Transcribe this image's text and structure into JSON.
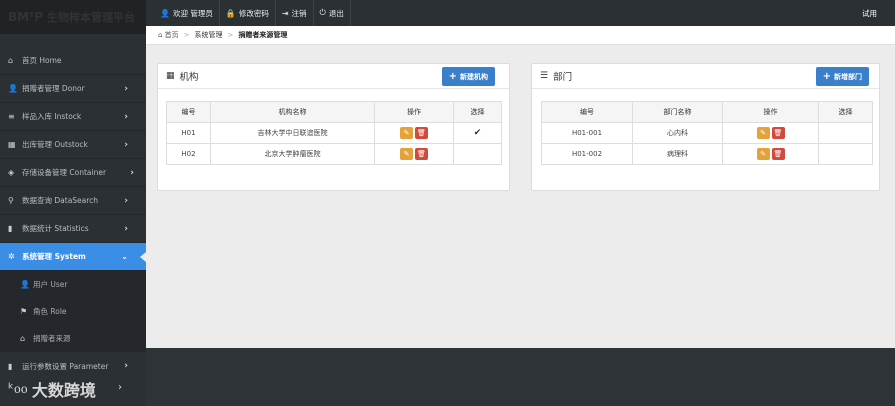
{
  "brand": {
    "logo": "BMᵀP",
    "title": "生物样本管理平台"
  },
  "topnav": [
    {
      "icon": "user-icon",
      "glyph": "👤",
      "label": "欢迎 管理员"
    },
    {
      "icon": "lock-icon",
      "glyph": "🔒",
      "label": "修改密码"
    },
    {
      "icon": "logout-icon",
      "glyph": "⇥",
      "label": "注销"
    },
    {
      "icon": "power-icon",
      "glyph": "⏻",
      "label": "退出"
    }
  ],
  "trial": "试用",
  "breadcrumb": {
    "home": "首页",
    "section": "系统管理",
    "current": "捐赠者来源管理"
  },
  "sidebar": {
    "items": [
      {
        "label": "首页 Home",
        "glyph": "⌂"
      },
      {
        "label": "捐赠者管理 Donor",
        "glyph": "👤"
      },
      {
        "label": "样品入库 Instock",
        "glyph": "≡"
      },
      {
        "label": "出库管理 Outstock",
        "glyph": "▦"
      },
      {
        "label": "存储设备管理 Container",
        "glyph": "◈"
      },
      {
        "label": "数据查询 DataSearch",
        "glyph": "⚲"
      },
      {
        "label": "数据统计 Statistics",
        "glyph": "▮"
      },
      {
        "label": "系统管理 System",
        "glyph": "✲"
      }
    ],
    "sub_items": [
      {
        "label": "用户 User",
        "glyph": "👤"
      },
      {
        "label": "角色 Role",
        "glyph": "⚑"
      },
      {
        "label": "捐赠者来源",
        "glyph": "⌂"
      }
    ],
    "bottom_item": {
      "label": "运行参数设置 Parameter",
      "glyph": "▮"
    }
  },
  "watermark": {
    "logo": "ᵏ᧐᧐",
    "text": "大数跨境"
  },
  "org_panel": {
    "title": "机构",
    "new_button": "新建机构",
    "headers": [
      "编号",
      "机构名称",
      "操作",
      "选择"
    ],
    "rows": [
      {
        "code": "H01",
        "name": "吉林大学中日联谊医院",
        "selected": "✔"
      },
      {
        "code": "H02",
        "name": "北京大学肿瘤医院",
        "selected": ""
      }
    ]
  },
  "dept_panel": {
    "title": "部门",
    "new_button": "新增部门",
    "headers": [
      "编号",
      "部门名称",
      "操作",
      "选择"
    ],
    "rows": [
      {
        "code": "H01-001",
        "name": "心内科",
        "selected": ""
      },
      {
        "code": "H01-002",
        "name": "病理科",
        "selected": ""
      }
    ]
  },
  "colors": {
    "active": "#3a8ee6",
    "primary_button": "#3a7fc9",
    "edit": "#e5a13a",
    "delete": "#d14a3e"
  }
}
